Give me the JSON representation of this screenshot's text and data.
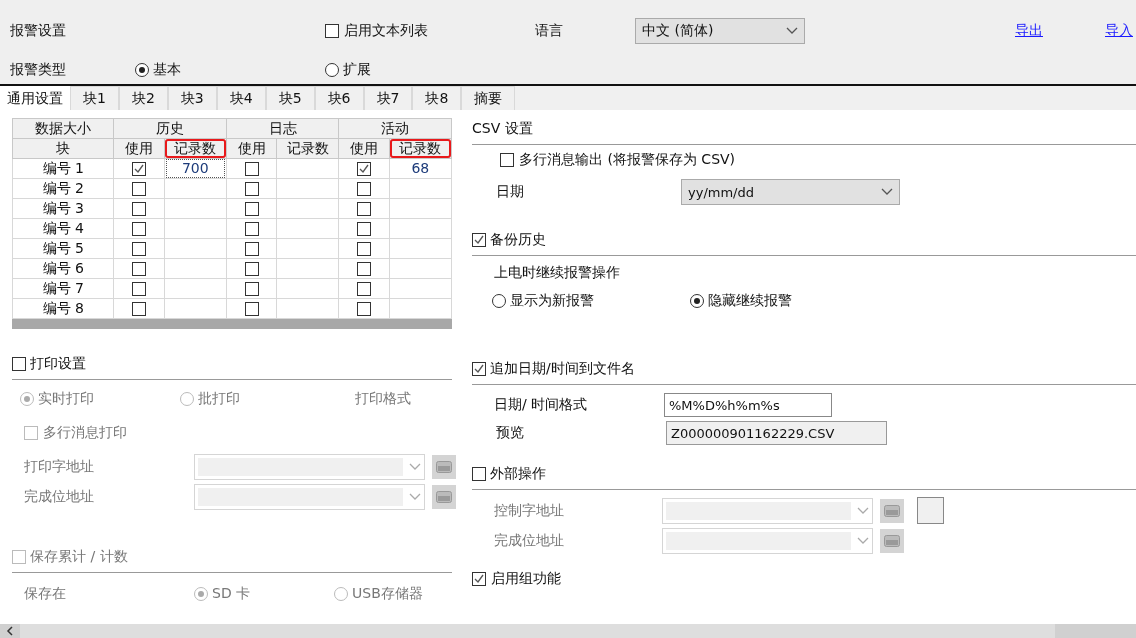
{
  "header": {
    "title": "报警设置",
    "enable_text_list": {
      "label": "启用文本列表",
      "checked": false
    },
    "language": {
      "label": "语言",
      "value": "中文 (简体)"
    },
    "links": [
      "导出",
      "导入"
    ],
    "alarm_type": {
      "label": "报警类型",
      "options": [
        {
          "label": "基本",
          "selected": true
        },
        {
          "label": "扩展",
          "selected": false
        }
      ]
    }
  },
  "tabs": [
    {
      "label": "通用设置",
      "selected": true
    },
    {
      "label": "块1",
      "selected": false
    },
    {
      "label": "块2",
      "selected": false
    },
    {
      "label": "块3",
      "selected": false
    },
    {
      "label": "块4",
      "selected": false
    },
    {
      "label": "块5",
      "selected": false
    },
    {
      "label": "块6",
      "selected": false
    },
    {
      "label": "块7",
      "selected": false
    },
    {
      "label": "块8",
      "selected": false
    },
    {
      "label": "摘要",
      "selected": false
    }
  ],
  "table": {
    "corner_top": "数据大小",
    "corner_bottom": "块",
    "groups": [
      {
        "name": "历史",
        "columns": [
          {
            "label": "使用",
            "highlighted": false
          },
          {
            "label": "记录数",
            "highlighted": true
          }
        ]
      },
      {
        "name": "日志",
        "columns": [
          {
            "label": "使用",
            "highlighted": false
          },
          {
            "label": "记录数",
            "highlighted": false
          }
        ]
      },
      {
        "name": "活动",
        "columns": [
          {
            "label": "使用",
            "highlighted": false
          },
          {
            "label": "记录数",
            "highlighted": true
          }
        ]
      }
    ],
    "rows": [
      {
        "label": "编号 1",
        "cells": [
          {
            "used": true,
            "count": "700",
            "focused": true
          },
          {
            "used": false,
            "focused": false
          },
          {
            "used": true,
            "count": "68",
            "focused": false
          }
        ]
      },
      {
        "label": "编号 2",
        "cells": [
          {
            "used": false,
            "focused": false
          },
          {
            "used": false,
            "focused": false
          },
          {
            "used": false,
            "focused": false
          }
        ]
      },
      {
        "label": "编号 3",
        "cells": [
          {
            "used": false,
            "focused": false
          },
          {
            "used": false,
            "focused": false
          },
          {
            "used": false,
            "focused": false
          }
        ]
      },
      {
        "label": "编号 4",
        "cells": [
          {
            "used": false,
            "focused": false
          },
          {
            "used": false,
            "focused": false
          },
          {
            "used": false,
            "focused": false
          }
        ]
      },
      {
        "label": "编号 5",
        "cells": [
          {
            "used": false,
            "focused": false
          },
          {
            "used": false,
            "focused": false
          },
          {
            "used": false,
            "focused": false
          }
        ]
      },
      {
        "label": "编号 6",
        "cells": [
          {
            "used": false,
            "focused": false
          },
          {
            "used": false,
            "focused": false
          },
          {
            "used": false,
            "focused": false
          }
        ]
      },
      {
        "label": "编号 7",
        "cells": [
          {
            "used": false,
            "focused": false
          },
          {
            "used": false,
            "focused": false
          },
          {
            "used": false,
            "focused": false
          }
        ]
      },
      {
        "label": "编号 8",
        "cells": [
          {
            "used": false,
            "focused": false
          },
          {
            "used": false,
            "focused": false
          },
          {
            "used": false,
            "focused": false
          }
        ]
      }
    ]
  },
  "print_settings": {
    "label": "打印设置",
    "checked": false,
    "modes": [
      {
        "label": "实时打印",
        "selected": true
      },
      {
        "label": "批打印",
        "selected": false
      }
    ],
    "format_label": "打印格式",
    "multiline": {
      "label": "多行消息打印",
      "checked": false
    },
    "fields": [
      {
        "label": "打印字地址"
      },
      {
        "label": "完成位地址"
      }
    ]
  },
  "save_totals": {
    "label": "保存累计 / 计数",
    "checked": false,
    "location_label": "保存在",
    "locations": [
      {
        "label": "SD 卡",
        "selected": true
      },
      {
        "label": "USB存储器",
        "selected": false
      }
    ]
  },
  "csv": {
    "title": "CSV 设置",
    "multiline_output": {
      "label": "多行消息输出 (将报警保存为 CSV)",
      "checked": false
    },
    "date": {
      "label": "日期",
      "value": "yy/mm/dd"
    }
  },
  "backup_history": {
    "label": "备份历史",
    "checked": true,
    "resume_label": "上电时继续报警操作",
    "resume_options": [
      {
        "label": "显示为新报警",
        "selected": false
      },
      {
        "label": "隐藏继续报警",
        "selected": true
      }
    ]
  },
  "append_datetime": {
    "label": "追加日期/时间到文件名",
    "checked": true,
    "format": {
      "label": "日期/ 时间格式",
      "value": "%M%D%h%m%s"
    },
    "preview": {
      "label": "预览",
      "value": "Z000000901162229.CSV"
    }
  },
  "external": {
    "label": "外部操作",
    "checked": false,
    "fields": [
      {
        "label": "控制字地址",
        "extra_box": true
      },
      {
        "label": "完成位地址",
        "extra_box": false
      }
    ]
  },
  "group_function": {
    "label": "启用组功能",
    "checked": true
  }
}
